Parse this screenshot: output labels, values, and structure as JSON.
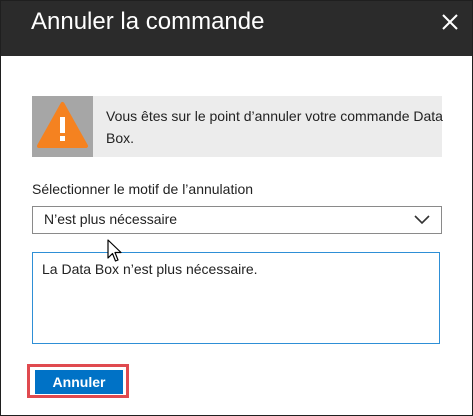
{
  "dialog": {
    "title": "Annuler la commande",
    "close_icon": "close-icon"
  },
  "alert": {
    "icon": "warning-icon",
    "message": "Vous êtes sur le point d’annuler votre commande Data Box."
  },
  "reason": {
    "label": "Sélectionner le motif de l’annulation",
    "selected": "N’est plus nécessaire",
    "chevron_icon": "chevron-down-icon"
  },
  "comment": {
    "value": "La Data Box n’est plus nécessaire."
  },
  "actions": {
    "cancel_label": "Annuler"
  },
  "colors": {
    "titlebar": "#2b2b2b",
    "warning": "#f58220",
    "primary_button": "#0072c6",
    "highlight": "#e04a4f",
    "focus_border": "#2e8fd6"
  }
}
